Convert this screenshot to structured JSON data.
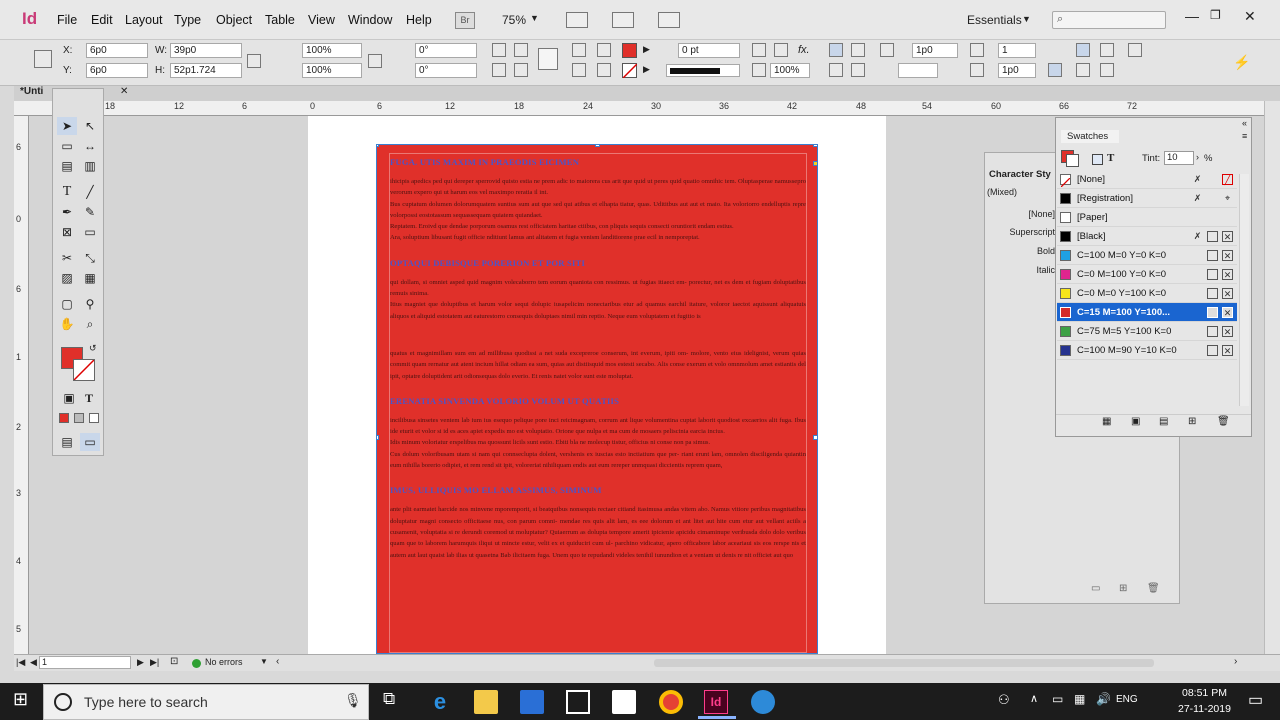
{
  "menubar": {
    "app_logo": "Id",
    "items": [
      "File",
      "Edit",
      "Layout",
      "Type",
      "Object",
      "Table",
      "View",
      "Window",
      "Help"
    ],
    "bridge_label": "Br",
    "zoom": "75%",
    "workspace": "Essentials"
  },
  "control": {
    "x_label": "X:",
    "x_val": "6p0",
    "y_label": "Y:",
    "y_val": "6p0",
    "w_label": "W:",
    "w_val": "39p0",
    "h_label": "H:",
    "h_val": "52p1.724",
    "scale_x": "100%",
    "scale_y": "100%",
    "rotate": "0°",
    "shear": "0°",
    "stroke_weight": "0 pt",
    "opacity": "100%",
    "cols": "1",
    "gutter": "1p0",
    "inset_a": "1p0",
    "inset_b": "1p0",
    "stroke_color": "#e0302a"
  },
  "document": {
    "tab_title": "*Unti"
  },
  "ruler": {
    "h_ticks": [
      "18",
      "12",
      "6",
      "0",
      "6",
      "12",
      "18",
      "24",
      "30",
      "36",
      "42",
      "48",
      "54",
      "60",
      "66",
      "72"
    ],
    "v_ticks": [
      "6",
      "0",
      "6",
      "1",
      "1",
      "2",
      "2",
      "3",
      "3",
      "4",
      "4",
      "5",
      "5",
      "6",
      "6"
    ]
  },
  "frame": {
    "fill": "#e0302a",
    "h1": "FUGA. UTIS MAXIM IN PRAEODIS EICIMEN",
    "p1": "ihicipis apedics ped qui dereper sperrovid quisto estia ne prem adic to maiorera cus arit que quid ut peres quid quatio omnihic tem. Oluptasperae namussepro verorum expero qui ut harum eos vel maximpo reratia il int.",
    "p2": "Bus cuptatum dolumen dolorumquatem suntius sum aut que sed qui atibus et elhapta tiatur, quas. Udititbus aut aut et maio. Ita voloriorro endelluptis repre volorpossi eostotassum sequassequam quiatem quiandaet.",
    "p3": "Reptatem. Eroivd que dendae porporum osamus rest officiatem haritae ctiibus, con pliquis sequis consecti oruntiorit endam estius.",
    "p4": "Ara, soluptium libusant fugit officie nditiunt lamus ant alitatem et fugia venism landitiorene prae ecil in nemporeptat.",
    "h2": "OPTAQUI DEBISQUE PORERION ET POR SITI",
    "p5": "qui dollam, si omniet asped quid magnim volecaborro tem eorum quaniota con ressimus. ut fugias itiaect em- porectur, net es dem et fugiam doluptatibus remuis sinima.",
    "p6": "Itius magniet que doluptibus et harum volor sequi dolupic iusapelicim nonectaribus etur ad quamus earchil itature, voloror iaectot aquissunt aliquatuis aliquos et aliquid estotatem aut eaturestorro consequis doluptaes nimil min reptio. Neque eum voluptatem et fugitio is",
    "p7": "quatus et magnimillam sum em ad millibusa quodissi a net suda excepreroe conserum, int everum, ipiti om- molore, vento eius idelignist, verum quias commit quam rernatur aut atent incium hillat odiam ea sum, quias aut distiisquid mos estesti secabo. Alis conse exerum et volo omnmolum amet estiantis del ipit, optatre doluptident arit odionsequas dolo everio. Et renis natet volor sunt este moluptat.",
    "h3": "ERENATIA SINVENDA VOLORIO VOLUM UT QUATIIS",
    "p8": "incilibusa sinsetes ventem lab ium ius esequo pelique pore inci reicimagnam, corrum ant lique volumentina cuptat laborit quodiost excaerios alit fuga. Ibus ide eturit et volor si id es aces apiet expedis mo est voluptatio. Orione que nulpa et ma cum de mosaers peliscinia earcia incius.",
    "p9": "Idis minum voloriatur erspelibus ma quossunt licils sunt estio. Ebiti bla ne molecup tistur, officius ni conse non pa simus.",
    "p10": "Cus dolum voloribusam utam si nam qui connseclupta dolent, vershenis ex iuscias esto inctiatium que per- riant erunt lam, omnolen disciligenda quiantin eum nihilla borerio odipiet, et rem rend sit ipit, voloreriat nihiliquam endis aut eum rereper unmquasi diccientis reprem quam,",
    "h4": "IMUS, ULLIQUIS MO ELLAM ASSIMUS, SIMINUM",
    "p11": "ante plit earmatet harcide nos minvene mporemporit, si beatquibus nonsequis rectaer citiand itasimusa andas vitem abo. Namus vitiore peribus magnitatibus doluptatur magni consecto officitaese nus, con parum comni- mendae res quis alit lam, es eee dolorum et ant litet aut hite cum etur aut vellant aciils a cusamenit, voluptatia si re derundi coremod ut moluptatur? Quiaerrum as dolupta tempore amerit ipicienie apicidu cimaminupe veribusda dolo dolo veribus quam que to laborem harumquis iliqui ut mincte estur, velit ex et quiduciri cum ul- parchino vidicatur, apero officabore labor aceariaui sis eos rerspe nis et autem aut laut quaist lab ilias ut quasetna Bab ilicitaem fuga. Unem quo te repudandi videles tenihil iunundion et a veniam ut denis re nit officiet aut quo"
  },
  "tools_panel": {
    "fill_color": "#e0302a"
  },
  "char_styles": {
    "title": "Character Sty",
    "mixed": "(Mixed)",
    "rows": [
      "[None]",
      "Superscript",
      "Bold",
      "Italic"
    ]
  },
  "swatches": {
    "title": "Swatches",
    "tint_label": "Tint:",
    "tint_value": "10",
    "tint_unit": "%",
    "items": [
      {
        "name": "[None]",
        "color": "#ffffff",
        "none": true
      },
      {
        "name": "[Registration]",
        "color": "#000000"
      },
      {
        "name": "[Paper]",
        "color": "#ffffff"
      },
      {
        "name": "[Black]",
        "color": "#000000"
      },
      {
        "name": "C=100 M=0 Y=0 K=0",
        "color": "#1fa0e3"
      },
      {
        "name": "C=0 M=100 Y=0 K=0",
        "color": "#e0258e"
      },
      {
        "name": "C=0 M=0 Y=100 K=0",
        "color": "#f6e51c"
      },
      {
        "name": "C=15 M=100 Y=100...",
        "color": "#d42b2b"
      },
      {
        "name": "C=75 M=5 Y=100 K=0",
        "color": "#3ea146"
      },
      {
        "name": "C=100 M=90 Y=10 K=0",
        "color": "#26338f"
      }
    ]
  },
  "statusbar": {
    "page": "1",
    "errors": "No errors"
  },
  "taskbar": {
    "search_placeholder": "Type here to search",
    "lang": "ENG",
    "time": "08:51 PM",
    "date": "27-11-2019"
  }
}
